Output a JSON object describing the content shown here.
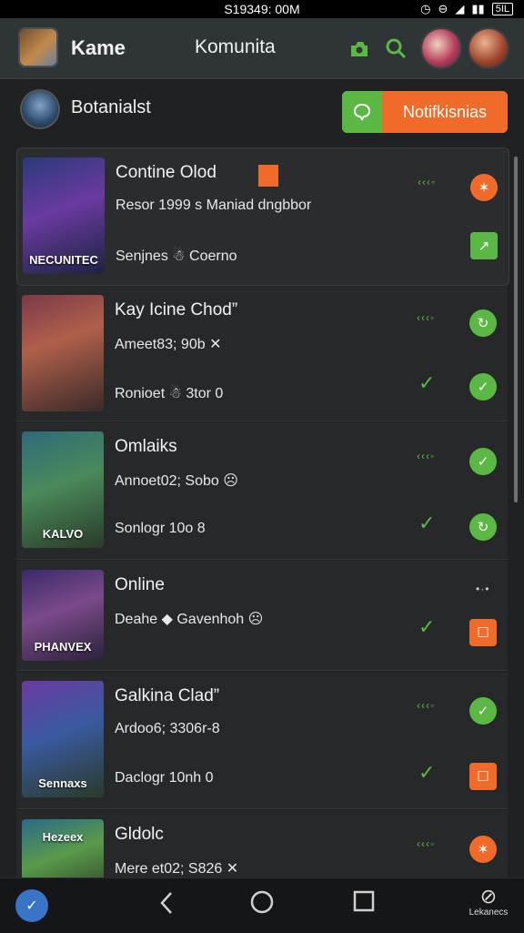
{
  "status": {
    "time": "S19349: 00M",
    "battery": "5IL"
  },
  "appbar": {
    "title": "Kame",
    "community": "Komunita"
  },
  "profile": {
    "name": "Botanialst",
    "notif_label": "Notifkisnias"
  },
  "cards": [
    {
      "title": "Contine Olod",
      "line2": "Resor 1999 s Maniad dngbbor",
      "line3": "Senjnes ☃ Coerno",
      "thumb_label": "NECUNITEC",
      "tiny": "‹‹‹◦"
    },
    {
      "title": "Kay Icine Chod”",
      "line2": "Ameet83; 90b ✕",
      "line3": "Ronioet ☃ 3tor 0",
      "thumb_label": "",
      "tiny": "‹‹‹◦"
    },
    {
      "title": "Omlaiks",
      "line2": "Annoet02; Sobo ☹",
      "line3": "Sonlogr 10o 8",
      "thumb_label": "KALVO",
      "tiny": "‹‹‹◦"
    },
    {
      "title": "Online",
      "line2": "Deahe ◆ Gavenhoh ☹",
      "line3": "",
      "thumb_label": "PHANVEX",
      "tiny": "•·•"
    },
    {
      "title": "Galkina Clad”",
      "line2": "Ardoo6; 3306r-8",
      "line3": "Daclogr 10nh 0",
      "thumb_label": "Sennaxs",
      "tiny": "‹‹‹◦"
    },
    {
      "title": "Gldolc",
      "line2": "Mere et02; S826 ✕",
      "line3": "",
      "thumb_label": "Hezeex",
      "tiny": "‹‹‹◦"
    }
  ],
  "nav": {
    "right_label": "Lekanecs"
  }
}
